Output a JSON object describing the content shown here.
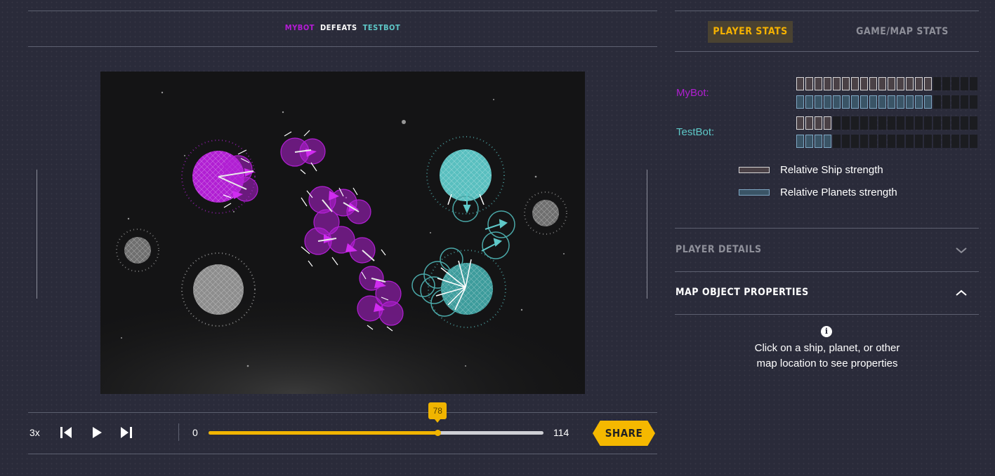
{
  "header": {
    "winner": "MYBOT",
    "verb": "DEFEATS",
    "loser": "TESTBOT",
    "winner_color": "#b51bd6",
    "loser_color": "#5ec8c8"
  },
  "tabs": [
    {
      "label": "PLAYER STATS",
      "active": true
    },
    {
      "label": "GAME/MAP STATS",
      "active": false
    }
  ],
  "players": [
    {
      "name": "MyBot:",
      "color": "#b01fd1",
      "ship_strength": 15,
      "planet_strength": 15,
      "segments": 20
    },
    {
      "name": "TestBot:",
      "color": "#5ec8c8",
      "ship_strength": 4,
      "planet_strength": 4,
      "segments": 20
    }
  ],
  "legend": {
    "ship": "Relative Ship strength",
    "planets": "Relative Planets strength"
  },
  "sections": {
    "player_details": "PLAYER DETAILS",
    "map_object_properties": "MAP OBJECT PROPERTIES"
  },
  "info": {
    "icon": "i",
    "line1": "Click on a ship, planet, or other",
    "line2": "map location to see properties"
  },
  "controls": {
    "speed": "3x",
    "frame_min": "0",
    "frame_max": "114",
    "current_frame": "78",
    "progress_fraction": 0.684,
    "share": "SHARE",
    "icons": [
      "skip-back-icon",
      "play-icon",
      "skip-forward-icon"
    ]
  },
  "colors": {
    "accent": "#f5b800",
    "mybot": "#b51bd6",
    "testbot": "#5ec8c8",
    "neutral": "#8a8a8a"
  }
}
